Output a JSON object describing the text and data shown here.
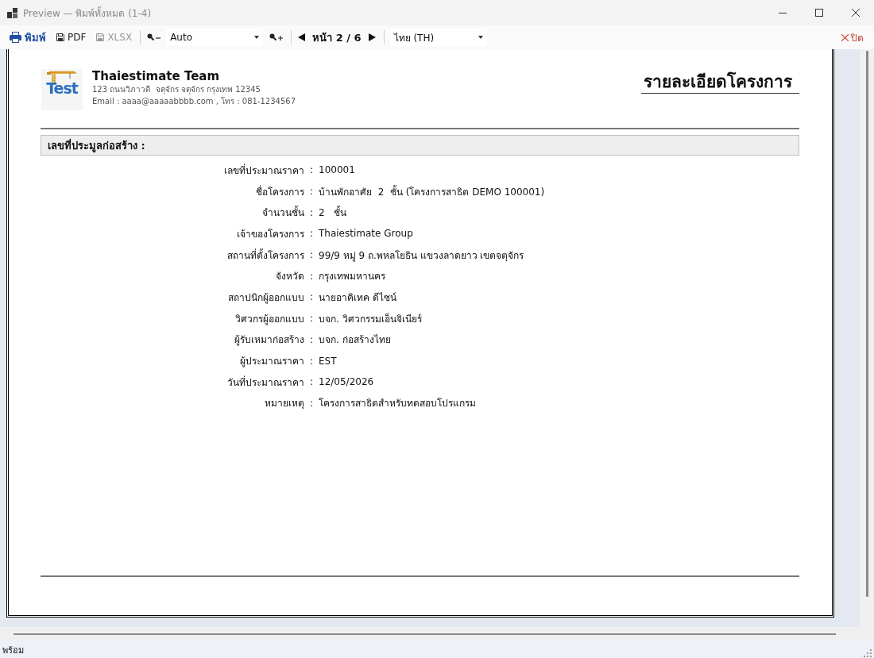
{
  "window": {
    "title": "Preview — พิมพ์ทั้งหมด (1-4)"
  },
  "toolbar": {
    "print": {
      "label": "พิมพ์"
    },
    "exports": [
      {
        "label": "PDF",
        "disabled": false
      },
      {
        "label": "XLSX",
        "disabled": true
      }
    ],
    "zoom": {
      "value": "Auto"
    },
    "page": {
      "label": "หน้า 2 / 6"
    },
    "language": {
      "value": "ไทย (TH)"
    },
    "close": {
      "label": "ปิด"
    }
  },
  "report": {
    "logo_text": "Test",
    "company": {
      "name": "Thaiestimate Team",
      "address": "123 ถนนวิภาวดี  จตุจักร จตุจักร กรุงเทพ 12345",
      "contact": "Email : aaaa@aaaaabbbb.com , โทร : 081-1234567"
    },
    "title": "รายละเอียดโครงการ",
    "section": "เลขที่ประมูลก่อสร้าง :",
    "fields": [
      {
        "label": "เลขที่ประมาณราคา",
        "separator": ":",
        "value": "100001"
      },
      {
        "label": "ชื่อโครงการ",
        "separator": ":",
        "value": "บ้านพักอาศัย  2  ชั้น (โครงการสาธิต DEMO 100001)"
      },
      {
        "label": "จำนวนชั้น",
        "separator": ":",
        "value": "2   ชั้น"
      },
      {
        "label": "เจ้าของโครงการ",
        "separator": ":",
        "value": "Thaiestimate Group"
      },
      {
        "label": "สถานที่ตั้งโครงการ",
        "separator": ":",
        "value": "99/9 หมู่ 9 ถ.พหลโยธิน แขวงลาดยาว เขตจตุจักร"
      },
      {
        "label": "จังหวัด",
        "separator": ":",
        "value": "กรุงเทพมหานคร"
      },
      {
        "label": "สถาปนิกผู้ออกแบบ",
        "separator": ":",
        "value": "นายอาคิเทค ดีไซน์"
      },
      {
        "label": "วิศวกรผู้ออกแบบ",
        "separator": ":",
        "value": "บจก. วิศวกรรมเอ็นจิเนียร์"
      },
      {
        "label": "ผู้รับเหมาก่อสร้าง",
        "separator": ":",
        "value": "บจก. ก่อสร้างไทย"
      },
      {
        "label": "ผู้ประมาณราคา",
        "separator": ":",
        "value": "EST"
      },
      {
        "label": "วันที่ประมาณราคา",
        "separator": ":",
        "value": "12/05/2026"
      },
      {
        "label": "หมายเหตุ",
        "separator": ":",
        "value": "โครงการสาธิตสำหรับทดสอบโปรแกรม"
      }
    ]
  },
  "status_bar": {
    "text": "พร้อม"
  }
}
